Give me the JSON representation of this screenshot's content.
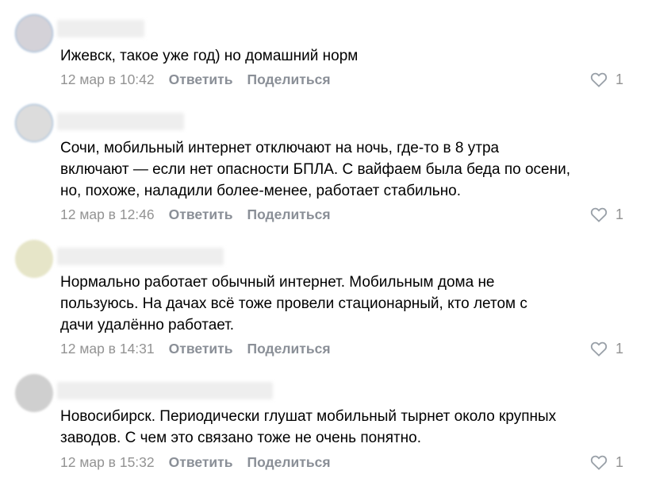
{
  "comments": [
    {
      "author": "",
      "text": "Ижевск, такое уже год) но домашний норм",
      "date": "12 мар в 10:42",
      "reply_label": "Ответить",
      "share_label": "Поделиться",
      "likes": "1",
      "avatar_color": "#d4d2d8"
    },
    {
      "author": "",
      "text": "Сочи, мобильный интернет отключают на ночь, где-то в 8 утра\nвключают — если нет опасности БПЛА. С вайфаем была беда по осени,\nно, похоже, наладили более-менее, работает стабильно.",
      "date": "12 мар в 12:46",
      "reply_label": "Ответить",
      "share_label": "Поделиться",
      "likes": "1",
      "avatar_color": "#dcdcdc"
    },
    {
      "author": "",
      "text": "Нормально работает обычный интернет. Мобильным дома не\nпользуюсь. На дачах всё тоже провели стационарный, кто летом с\nдачи удалённо работает.",
      "date": "12 мар в 14:31",
      "reply_label": "Ответить",
      "share_label": "Поделиться",
      "likes": "1",
      "avatar_color": "#e6e5c8"
    },
    {
      "author": "",
      "text": "Новосибирск. Периодически глушат мобильный тырнет около крупных\nзаводов. С чем это связано тоже не очень понятно.",
      "date": "12 мар в 15:32",
      "reply_label": "Ответить",
      "share_label": "Поделиться",
      "likes": "1",
      "avatar_color": "#cfcfcf"
    }
  ]
}
